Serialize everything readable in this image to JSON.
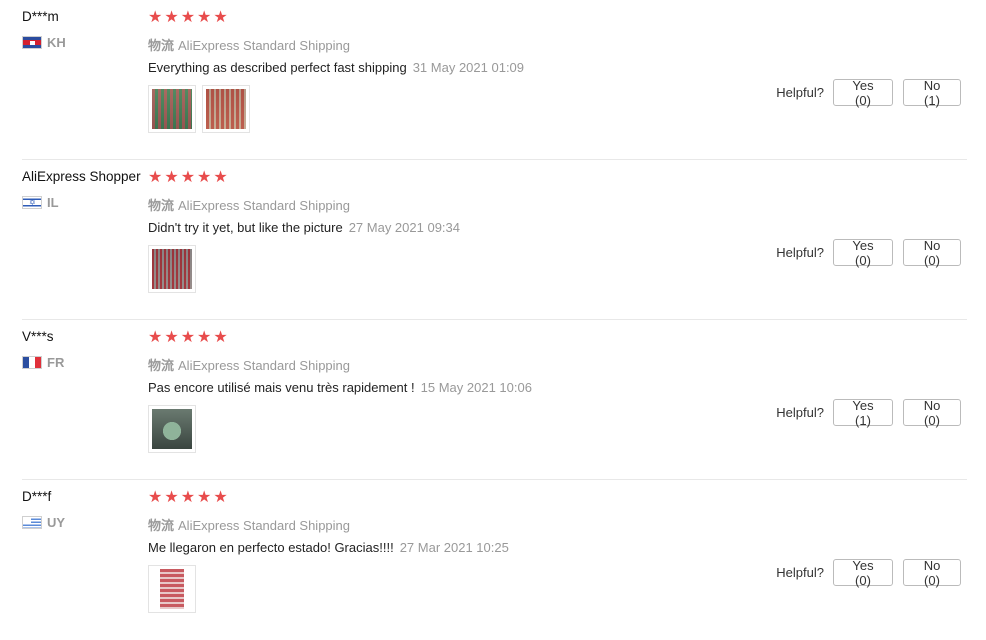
{
  "reviews": [
    {
      "user": "D***m",
      "country": "KH",
      "flag": "flag-kh",
      "rating": 5,
      "shipping_label": "物流",
      "shipping_method": "AliExpress Standard Shipping",
      "text": "Everything as described perfect fast shipping",
      "date": "31 May 2021 01:09",
      "images": 2,
      "helpful_label": "Helpful?",
      "yes": "Yes (0)",
      "no": "No (1)"
    },
    {
      "user": "AliExpress Shopper",
      "country": "IL",
      "flag": "flag-il",
      "rating": 5,
      "shipping_label": "物流",
      "shipping_method": "AliExpress Standard Shipping",
      "text": "Didn't try it yet, but like the picture",
      "date": "27 May 2021 09:34",
      "images": 1,
      "helpful_label": "Helpful?",
      "yes": "Yes (0)",
      "no": "No (0)"
    },
    {
      "user": "V***s",
      "country": "FR",
      "flag": "flag-fr",
      "rating": 5,
      "shipping_label": "物流",
      "shipping_method": "AliExpress Standard Shipping",
      "text": "Pas encore utilisé mais venu très rapidement !",
      "date": "15 May 2021 10:06",
      "images": 1,
      "helpful_label": "Helpful?",
      "yes": "Yes (1)",
      "no": "No (0)"
    },
    {
      "user": "D***f",
      "country": "UY",
      "flag": "flag-uy",
      "rating": 5,
      "shipping_label": "物流",
      "shipping_method": "AliExpress Standard Shipping",
      "text": "Me llegaron en perfecto estado! Gracias!!!!",
      "date": "27 Mar 2021 10:25",
      "images": 1,
      "helpful_label": "Helpful?",
      "yes": "Yes (0)",
      "no": "No (0)"
    }
  ],
  "colors": {
    "star": "#e84c4c",
    "muted": "#999999",
    "divider": "#e8e8e8"
  },
  "icons": {
    "star": "star-icon",
    "image": "review-photo-thumbnail"
  }
}
